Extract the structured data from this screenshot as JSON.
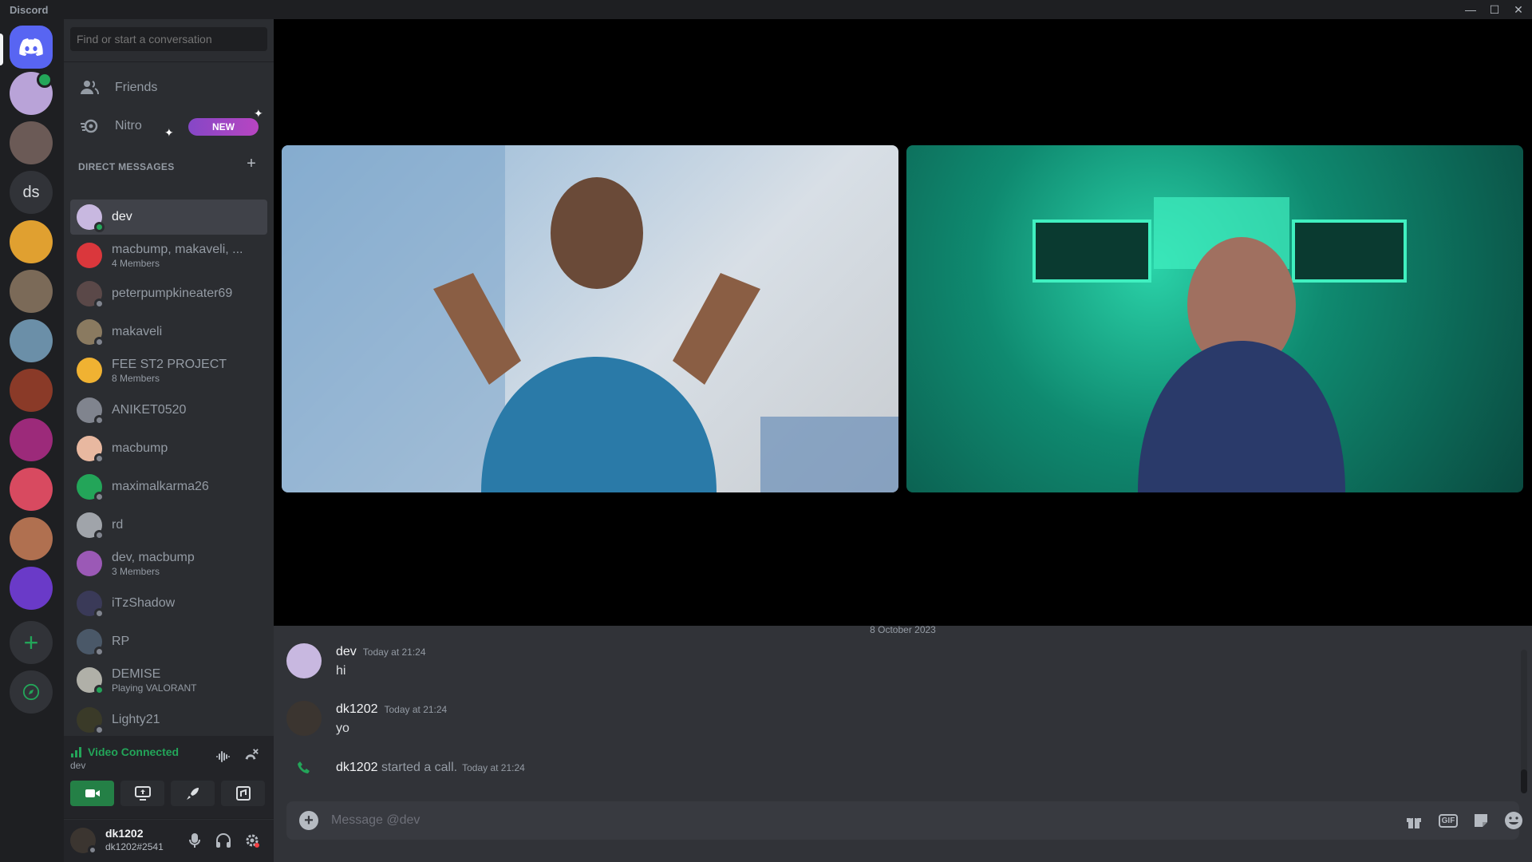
{
  "app": {
    "title": "Discord"
  },
  "window": {
    "minimize": "—",
    "maximize": "☐",
    "close": "✕"
  },
  "guilds": [
    {
      "name": "direct-messages-home",
      "color": "#5865f2"
    },
    {
      "name": "server-1",
      "color": "#b9a3d8"
    },
    {
      "name": "server-2",
      "color": "#6b5a56"
    },
    {
      "name": "ds",
      "label": "ds",
      "color": "#313338"
    },
    {
      "name": "server-4",
      "color": "#e0a030"
    },
    {
      "name": "server-5",
      "color": "#7b6a58"
    },
    {
      "name": "server-6",
      "color": "#6b8fa8"
    },
    {
      "name": "server-7",
      "color": "#8a3a28"
    },
    {
      "name": "server-8",
      "color": "#9c2a7a"
    },
    {
      "name": "server-9",
      "color": "#d84a60"
    },
    {
      "name": "server-10",
      "color": "#b07050"
    },
    {
      "name": "server-11",
      "color": "#6a3ac8"
    }
  ],
  "search": {
    "placeholder": "Find or start a conversation"
  },
  "nav": {
    "friends": "Friends",
    "nitro": "Nitro",
    "new_badge": "NEW"
  },
  "direct_messages": {
    "header": "DIRECT MESSAGES",
    "items": [
      {
        "name": "dev",
        "sub": "",
        "color": "#c8b8e0",
        "status": "#23a559",
        "active": true
      },
      {
        "name": "macbump, makaveli, ...",
        "sub": "4 Members",
        "color": "#da373c",
        "status": "",
        "active": false
      },
      {
        "name": "peterpumpkineater69",
        "sub": "",
        "color": "#5a4848",
        "status": "#80848e",
        "active": false
      },
      {
        "name": "makaveli",
        "sub": "",
        "color": "#8a7a60",
        "status": "#80848e",
        "active": false
      },
      {
        "name": "FEE ST2 PROJECT",
        "sub": "8 Members",
        "color": "#f0b232",
        "status": "",
        "active": false
      },
      {
        "name": "ANIKET0520",
        "sub": "",
        "color": "#80848e",
        "status": "#80848e",
        "active": false
      },
      {
        "name": "macbump",
        "sub": "",
        "color": "#e8b8a0",
        "status": "#80848e",
        "active": false
      },
      {
        "name": "maximalkarma26",
        "sub": "",
        "color": "#23a559",
        "status": "#80848e",
        "active": false
      },
      {
        "name": "rd",
        "sub": "",
        "color": "#a0a4aa",
        "status": "#80848e",
        "active": false
      },
      {
        "name": "dev, macbump",
        "sub": "3 Members",
        "color": "#9b59b6",
        "status": "",
        "active": false
      },
      {
        "name": "iTzShadow",
        "sub": "",
        "color": "#3a3a58",
        "status": "#80848e",
        "active": false
      },
      {
        "name": "RP",
        "sub": "",
        "color": "#4a5868",
        "status": "#80848e",
        "active": false
      },
      {
        "name": "DEMISE",
        "sub": "Playing VALORANT",
        "color": "#b0b0a8",
        "status": "#23a559",
        "active": false
      },
      {
        "name": "Lighty21",
        "sub": "",
        "color": "#3a3a28",
        "status": "#80848e",
        "active": false
      }
    ]
  },
  "voice": {
    "status": "Video Connected",
    "channel": "dev"
  },
  "user": {
    "name": "dk1202",
    "tag": "dk1202#2541"
  },
  "chat": {
    "date_divider": "8 October 2023",
    "messages": [
      {
        "author": "dev",
        "time": "Today at 21:24",
        "content": "hi",
        "color": "#c8b8e0"
      },
      {
        "author": "dk1202",
        "time": "Today at 21:24",
        "content": "yo",
        "color": "#3b3530"
      }
    ],
    "system": {
      "author": "dk1202",
      "text": "started a call.",
      "time": "Today at 21:24"
    },
    "composer_placeholder": "Message @dev"
  }
}
